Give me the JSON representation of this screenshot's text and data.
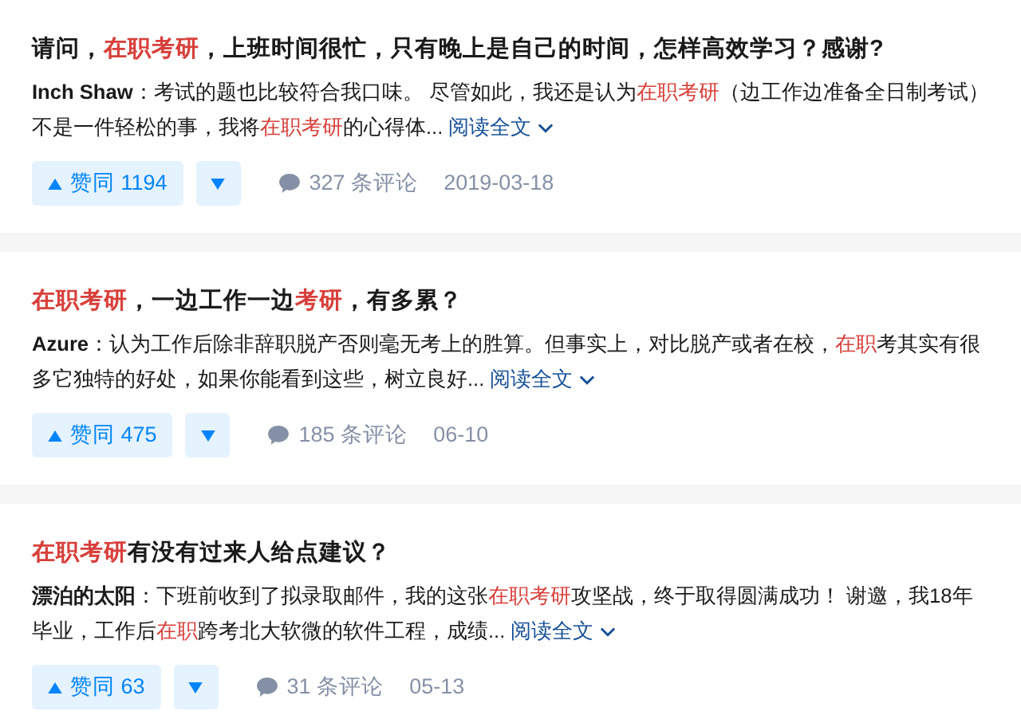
{
  "cards": [
    {
      "title": [
        {
          "text": "请问，",
          "highlight": false
        },
        {
          "text": "在职考研",
          "highlight": true
        },
        {
          "text": "，上班时间很忙，只有晚上是自己的时间，怎样高效学习？感谢?",
          "highlight": false
        }
      ],
      "author": "Inch Shaw",
      "excerpt": [
        {
          "text": "：考试的题也比较符合我口味。 尽管如此，我还是认为",
          "highlight": false
        },
        {
          "text": "在职考研",
          "highlight": true
        },
        {
          "text": "（边工作边准备全日制考试）不是一件轻松的事，我将",
          "highlight": false
        },
        {
          "text": "在职考研",
          "highlight": true
        },
        {
          "text": "的心得体...",
          "highlight": false
        }
      ],
      "read_more": "阅读全文",
      "upvote": "赞同 1194",
      "comments": "327 条评论",
      "date": "2019-03-18"
    },
    {
      "title": [
        {
          "text": "在职考研",
          "highlight": true
        },
        {
          "text": "，一边工作一边",
          "highlight": false
        },
        {
          "text": "考研",
          "highlight": true
        },
        {
          "text": "，有多累？",
          "highlight": false
        }
      ],
      "author": "Azure",
      "excerpt": [
        {
          "text": "：认为工作后除非辞职脱产否则毫无考上的胜算。但事实上，对比脱产或者在校，",
          "highlight": false
        },
        {
          "text": "在职",
          "highlight": true
        },
        {
          "text": "考其实有很多它独特的好处，如果你能看到这些，树立良好...",
          "highlight": false
        }
      ],
      "read_more": "阅读全文",
      "upvote": "赞同 475",
      "comments": "185 条评论",
      "date": "06-10"
    },
    {
      "title": [
        {
          "text": "在职考研",
          "highlight": true
        },
        {
          "text": "有没有过来人给点建议？",
          "highlight": false
        }
      ],
      "author": "漂泊的太阳",
      "excerpt": [
        {
          "text": "：下班前收到了拟录取邮件，我的这张",
          "highlight": false
        },
        {
          "text": "在职考研",
          "highlight": true
        },
        {
          "text": "攻坚战，终于取得圆满成功！ 谢邀，我18年毕业，工作后",
          "highlight": false
        },
        {
          "text": "在职",
          "highlight": true
        },
        {
          "text": "跨考北大软微的软件工程，成绩...",
          "highlight": false
        }
      ],
      "read_more": "阅读全文",
      "upvote": "赞同 63",
      "comments": "31 条评论",
      "date": "05-13"
    }
  ]
}
